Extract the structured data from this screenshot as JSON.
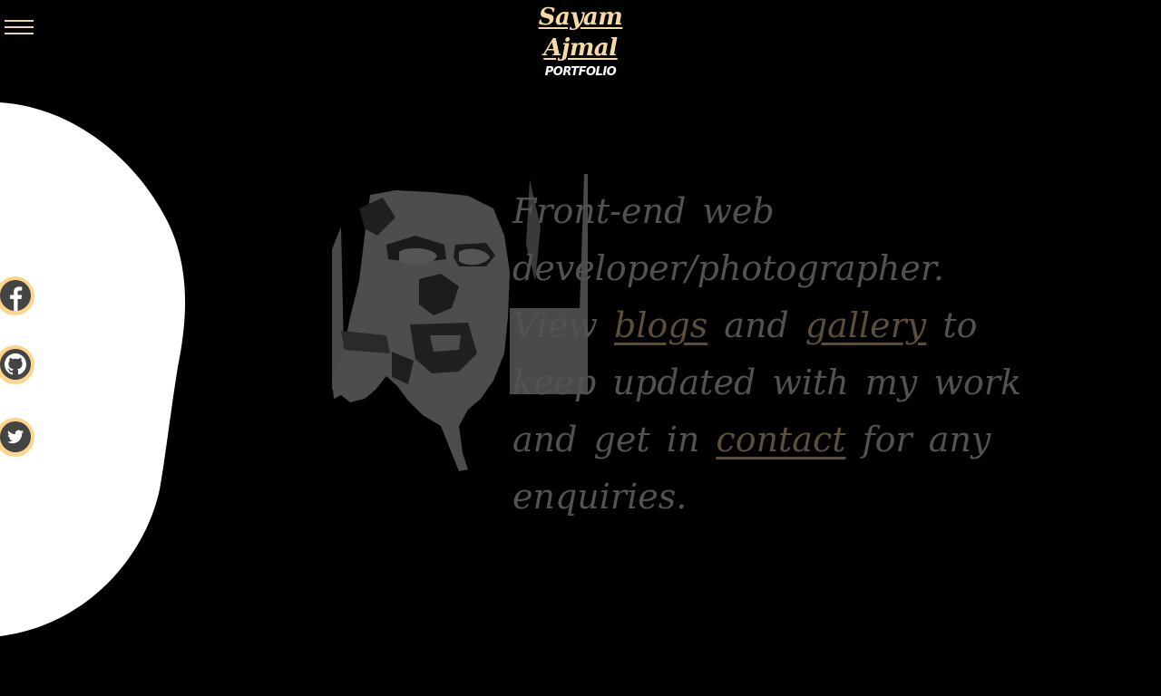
{
  "header": {
    "brand_name": "Sayam Ajmal",
    "brand_subtitle": "PORTFOLIO"
  },
  "social": {
    "items": [
      {
        "name": "facebook",
        "icon": "facebook-icon"
      },
      {
        "name": "github",
        "icon": "github-icon"
      },
      {
        "name": "twitter",
        "icon": "twitter-icon"
      }
    ]
  },
  "intro": {
    "part1": "Front-end web developer/photographer. View ",
    "blogs_link": "blogs",
    "part2": " and ",
    "gallery_link": "gallery",
    "part3": " to keep updated with my work and get in ",
    "contact_link": "contact",
    "part4": " for any enquiries."
  },
  "colors": {
    "background": "#000000",
    "accent": "#fcd58a",
    "blob": "#ffffff",
    "text": "#525252",
    "icon_fill": "#444444"
  }
}
